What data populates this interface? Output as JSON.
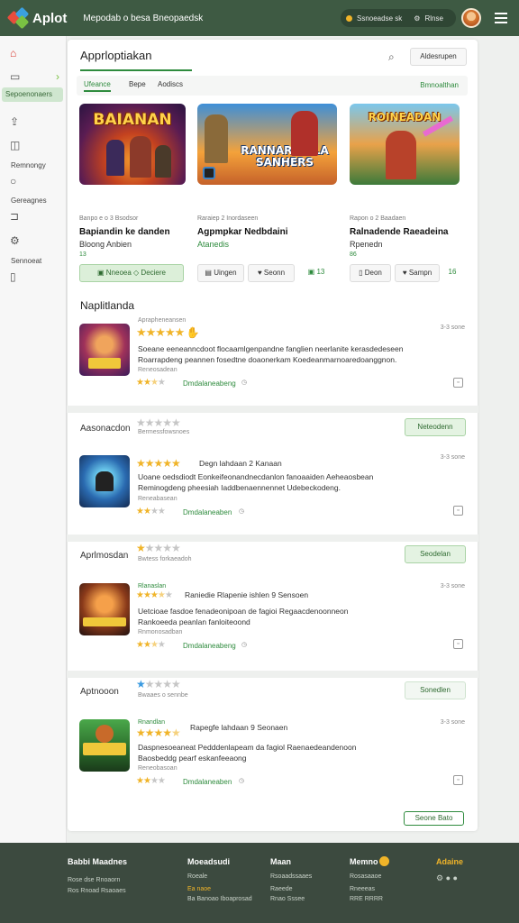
{
  "app": {
    "name": "Aplot",
    "header_title": "Mepodab o besa Bneopaedsk"
  },
  "header": {
    "search_text": "Ssnoeadse sk",
    "filter_label": "Rlnse"
  },
  "sidebar": {
    "active_label": "Sepoenonaers",
    "labels": [
      "Remnongy",
      "Gereagnes",
      "Sennoeat"
    ]
  },
  "main": {
    "title": "Apprloptiakan",
    "action_button": "Aldesrupen",
    "tabs": [
      "Ufeance",
      "Bepe",
      "Aodiscs"
    ],
    "tabs_link": "Bmnoalthan"
  },
  "featured": [
    {
      "art_title": "BAIANAN",
      "meta": "Banpo e o 3 Bsodsor",
      "name": "Bapiandin ke danden",
      "sub": "Bloong Anbien",
      "badge": "13",
      "buttons": [
        "Nneoea",
        "Deciere"
      ]
    },
    {
      "art_title": "RANNAR NALA SANHERS",
      "meta": "Raraiep 2 Inordaseen",
      "name": "Agpmpkar Nedbdaini",
      "sub": "Atanedis",
      "badge": "",
      "buttons": [
        "Uingen",
        "Seonn",
        "13"
      ]
    },
    {
      "art_title": "ROINEADAN",
      "meta": "Rapon o 2 Baadaen",
      "name": "Ralnadende Raeadeina",
      "sub": "Rpenedn",
      "badge": "86",
      "buttons": [
        "Deon",
        "Sampn",
        "16"
      ]
    }
  ],
  "section": {
    "title": "Naplitlanda"
  },
  "reviews": [
    {
      "label": "",
      "top": "Aprapheneansen",
      "stars": 5,
      "line1": "Soeane eeneanncdoot flocaamlgenpandne fanglien neerlanite kerasdedeseen",
      "line2": "Roarrapdeng peannen fosedtne doaonerkam Koedeanmarnoaredoanggnon.",
      "meta": "Reneosadean",
      "rating_stars": 2.5,
      "link": "Dmdalaneabeng",
      "date": "3-3 sone",
      "pill": ""
    },
    {
      "label": "Aasonacdon",
      "top": "Bermessfowsnoes",
      "stars": 0,
      "headline": "Degn lahdaan 2 Kanaan",
      "headline_stars": 5,
      "line1": "Uoane oedsdiodt Eonkeifeonandnecdanlon fanoaaiden Aeheaosbean",
      "line2": "Reminogdeng pheesiah Iaddbenaennennet Udebeckodeng.",
      "meta": "Reneabasean",
      "rating_stars": 2,
      "link": "Dmdalaneaben",
      "date": "3-3 sone",
      "pill": "Neteodenn"
    },
    {
      "label": "Aprlmosdan",
      "top": "Bwtess forkaeadoh",
      "stars": 1,
      "headline": "Raniedie Rlapenie ishlen 9 Sensoen",
      "headline_pre": "Rlanaslan",
      "headline_stars": 3.5,
      "line1": "Uetcioae fasdoe fenadeonipoan de fagioi Regaacdenoonneon",
      "line2": "Rankoeeda peanlan fanloiteoond",
      "meta": "Rnmonosadban",
      "rating_stars": 2.5,
      "link": "Dmdalaneabeng",
      "date": "3-3 sone",
      "pill": "Seodelan"
    },
    {
      "label": "Aptnooon",
      "top": "Bwaaes o sennbe",
      "stars": 1,
      "headline": "Rapegfe lahdaan 9 Seonaen",
      "headline_pre": "Rnandlan",
      "headline_stars": 4.5,
      "line1": "Daspnesoeaneat Pedddenlapeam da fagiol Raenaedeandenoon",
      "line2": "Baosbeddg pearf eskanfeeaong",
      "meta": "Reneobasoan",
      "rating_stars": 2,
      "link": "Dmdalaneaben",
      "date": "3-3 sone",
      "pill": "Sonedlen"
    }
  ],
  "bottom_button": "Seone Bato",
  "footer": {
    "columns": [
      {
        "head": "Babbi Maadnes",
        "items": [
          "Rose dse Rnoaorn",
          "Ros Rnoad Rsaoaes"
        ]
      },
      {
        "head": "Moeadsudi",
        "items": [
          "Roeale",
          "Ea naoe",
          "Ba Banoao Iboaprosad"
        ]
      },
      {
        "head": "Maan",
        "items": [
          "Rsoaadssaaes",
          "Raeede",
          "Rnao Sssee"
        ]
      },
      {
        "head": "Memno",
        "items": [
          "Rosasaaoe",
          "Rneeeas",
          "RRE RRRR"
        ]
      },
      {
        "head": "Adaine",
        "items": []
      }
    ]
  }
}
